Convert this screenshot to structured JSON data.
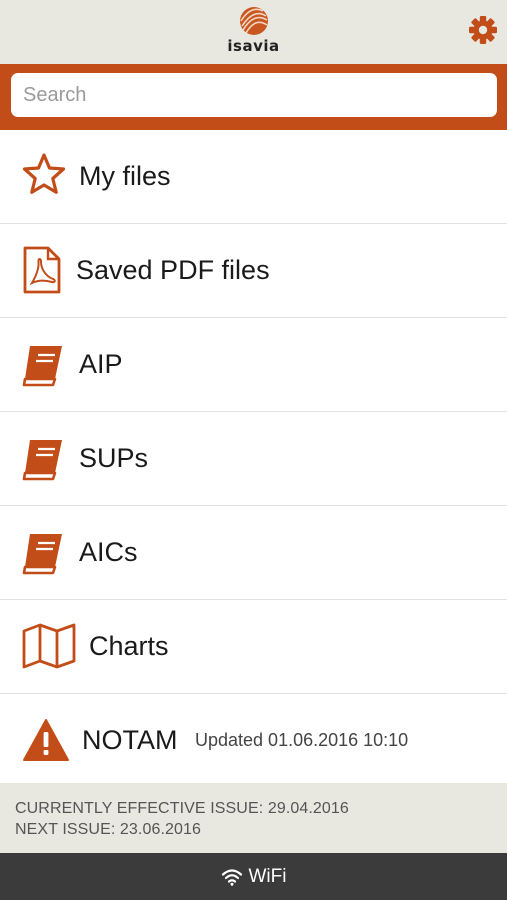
{
  "header": {
    "logo_text": "isavia",
    "settings_icon": "gear-icon",
    "accent_color": "#c24d18"
  },
  "search": {
    "placeholder": "Search",
    "value": ""
  },
  "menu": {
    "items": [
      {
        "label": "My files",
        "icon": "star-icon"
      },
      {
        "label": "Saved PDF files",
        "icon": "pdf-file-icon"
      },
      {
        "label": "AIP",
        "icon": "book-icon"
      },
      {
        "label": "SUPs",
        "icon": "book-icon"
      },
      {
        "label": "AICs",
        "icon": "book-icon"
      },
      {
        "label": "Charts",
        "icon": "map-icon"
      },
      {
        "label": "NOTAM",
        "icon": "warning-icon",
        "sub": "Updated 01.06.2016 10:10"
      }
    ]
  },
  "issue": {
    "current": "CURRENTLY EFFECTIVE ISSUE: 29.04.2016",
    "next": "NEXT ISSUE: 23.06.2016"
  },
  "status": {
    "connection": "WiFi",
    "icon": "wifi-icon"
  }
}
